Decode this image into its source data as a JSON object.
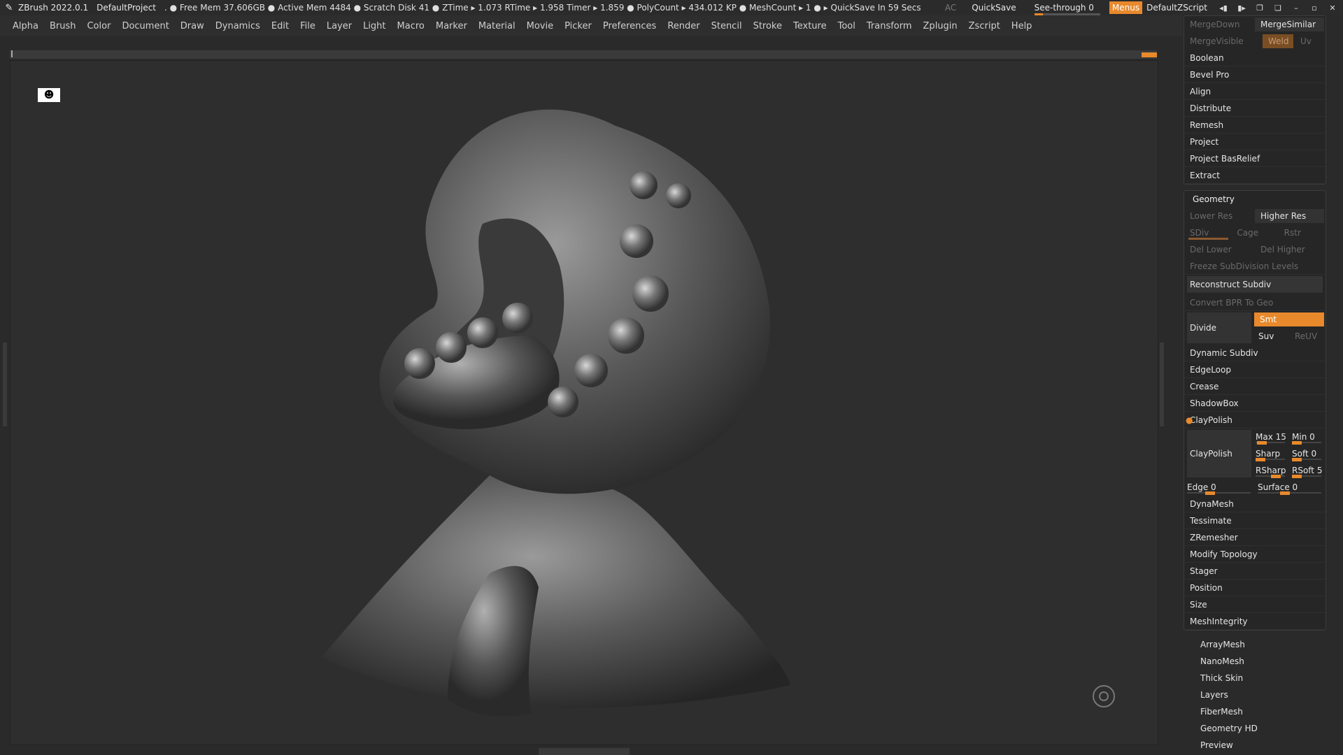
{
  "titlebar": {
    "app": "ZBrush 2022.0.1",
    "project": "DefaultProject",
    "stats": ". ● Free Mem 37.606GB ● Active Mem 4484 ● Scratch Disk 41 ● ZTime ▸ 1.073 RTime ▸ 1.958 Timer ▸ 1.859 ● PolyCount ▸ 434.012 KP ● MeshCount ▸ 1 ● ▸ QuickSave In 59 Secs",
    "ac": "AC",
    "quicksave": "QuickSave",
    "see_through": "See-through  0",
    "menus": "Menus",
    "default_zscript": "DefaultZScript"
  },
  "menubar": [
    "Alpha",
    "Brush",
    "Color",
    "Document",
    "Draw",
    "Dynamics",
    "Edit",
    "File",
    "Layer",
    "Light",
    "Macro",
    "Marker",
    "Material",
    "Movie",
    "Picker",
    "Preferences",
    "Render",
    "Stencil",
    "Stroke",
    "Texture",
    "Tool",
    "Transform",
    "Zplugin",
    "Zscript",
    "Help"
  ],
  "panel": {
    "merge_down": "MergeDown",
    "merge_similar": "MergeSimilar",
    "merge_visible": "MergeVisible",
    "weld": "Weld",
    "uv": "Uv",
    "top_items": [
      "Boolean",
      "Bevel Pro",
      "Align",
      "Distribute",
      "Remesh",
      "Project",
      "Project BasRelief",
      "Extract"
    ],
    "geometry": {
      "title": "Geometry",
      "lower_res": "Lower Res",
      "higher_res": "Higher Res",
      "sdiv": "SDiv",
      "cage": "Cage",
      "rstr": "Rstr",
      "del_lower": "Del Lower",
      "del_higher": "Del Higher",
      "freeze": "Freeze SubDivision Levels",
      "reconstruct": "Reconstruct Subdiv",
      "convert_bpr": "Convert BPR To Geo",
      "divide": "Divide",
      "smt": "Smt",
      "suv": "Suv",
      "reuv": "ReUV",
      "items": [
        "Dynamic Subdiv",
        "EdgeLoop",
        "Crease",
        "ShadowBox"
      ],
      "claypolish_header": "ClayPolish",
      "claypolish_btn": "ClayPolish",
      "max": "Max 15",
      "min": "Min 0",
      "sharp": "Sharp",
      "soft": "Soft 0",
      "rsharp": "RSharp",
      "rsoft": "RSoft 5",
      "edge": "Edge 0",
      "surface": "Surface 0",
      "lower_items": [
        "DynaMesh",
        "Tessimate",
        "ZRemesher",
        "Modify Topology",
        "Stager",
        "Position",
        "Size",
        "MeshIntegrity"
      ]
    },
    "outer_items": [
      "ArrayMesh",
      "NanoMesh",
      "Thick Skin",
      "Layers",
      "FiberMesh",
      "Geometry HD",
      "Preview"
    ]
  }
}
